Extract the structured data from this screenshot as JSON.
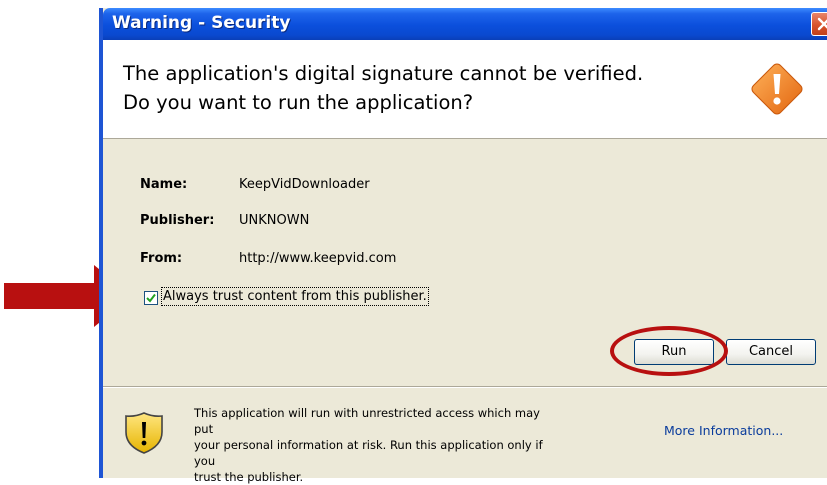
{
  "window": {
    "title": "Warning - Security"
  },
  "header": {
    "line1": "The application's digital signature cannot be verified.",
    "line2": "Do you want to run the application?"
  },
  "fields": {
    "name_label": "Name:",
    "name_value": "KeepVidDownloader",
    "publisher_label": "Publisher:",
    "publisher_value": "UNKNOWN",
    "from_label": "From:",
    "from_value": "http://www.keepvid.com"
  },
  "trust": {
    "label": "Always trust content from this publisher.",
    "checked": true
  },
  "buttons": {
    "run": "Run",
    "cancel": "Cancel"
  },
  "footer": {
    "line1": "This application will run with unrestricted access which may put",
    "line2": "your personal information at risk. Run this application only if you",
    "line3": "trust the publisher.",
    "more_link": "More Information..."
  },
  "icons": {
    "warning": "warning-diamond-icon",
    "shield": "shield-warning-icon",
    "close": "close-icon",
    "check": "checkmark-icon"
  },
  "colors": {
    "titlebar": "#0b4fdc",
    "annotation_red": "#b81010",
    "warning_orange": "#f08a24",
    "link": "#0a3c9c"
  }
}
